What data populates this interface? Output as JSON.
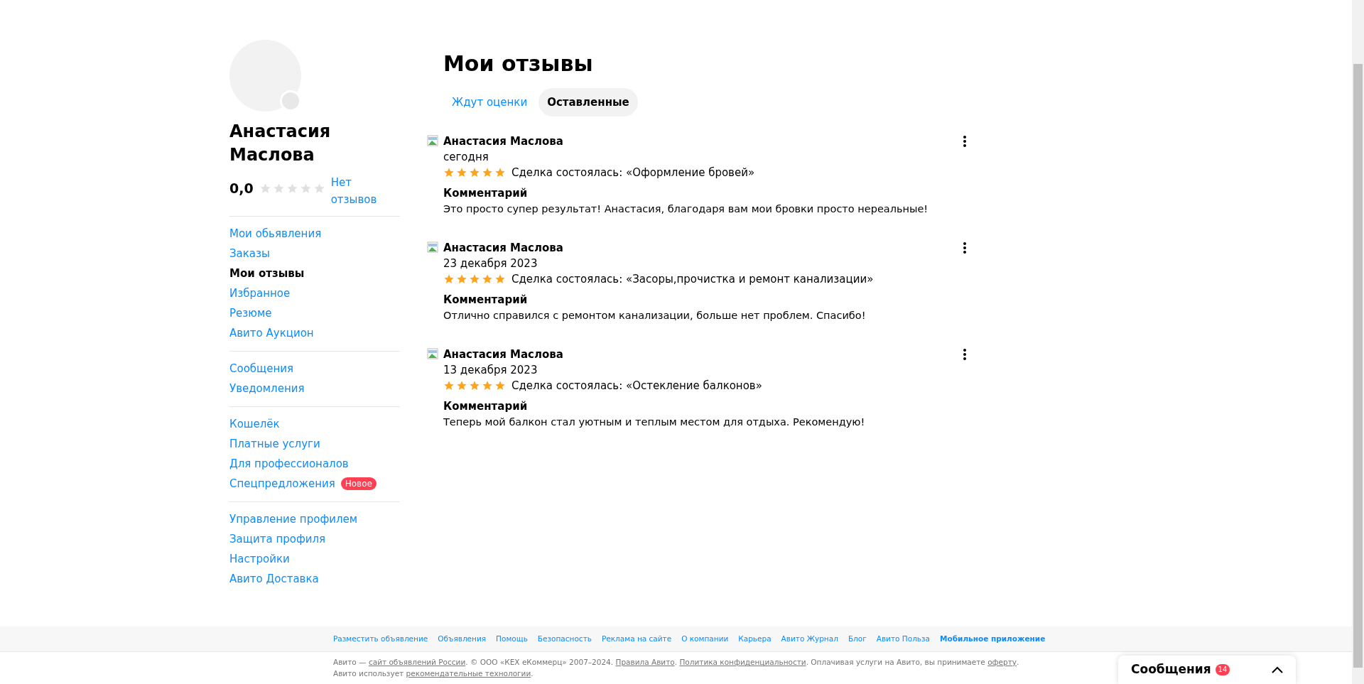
{
  "profile": {
    "name": "Анастасия Маслова",
    "rating": "0,0",
    "stars": 0,
    "reviews_link": "Нет отзывов"
  },
  "sidebar": {
    "groups": [
      {
        "items": [
          {
            "label": "Мои обьявления",
            "selected": false
          },
          {
            "label": "Заказы",
            "selected": false
          },
          {
            "label": "Мои отзывы",
            "selected": true
          },
          {
            "label": "Избранное",
            "selected": false
          },
          {
            "label": "Резюме",
            "selected": false
          },
          {
            "label": "Авито Аукцион",
            "selected": false
          }
        ]
      },
      {
        "items": [
          {
            "label": "Сообщения",
            "selected": false
          },
          {
            "label": "Уведомления",
            "selected": false
          }
        ]
      },
      {
        "items": [
          {
            "label": "Кошелёк",
            "selected": false
          },
          {
            "label": "Платные услуги",
            "selected": false
          },
          {
            "label": "Для профессионалов",
            "selected": false
          },
          {
            "label": "Спецпредложения",
            "selected": false,
            "badge": "Новое"
          }
        ]
      },
      {
        "items": [
          {
            "label": "Управление профилем",
            "selected": false
          },
          {
            "label": "Защита профиля",
            "selected": false
          },
          {
            "label": "Настройки",
            "selected": false
          },
          {
            "label": "Авито Доставка",
            "selected": false
          }
        ]
      }
    ]
  },
  "page": {
    "title": "Мои отзывы",
    "tabs": [
      {
        "label": "Ждут оценки",
        "selected": false
      },
      {
        "label": "Оставленные",
        "selected": true
      }
    ]
  },
  "reviews": [
    {
      "author": "Анастасия Маслова",
      "date": "сегодня",
      "stars": 5,
      "deal": "Сделка состоялась: «Оформление бровей»",
      "comment_label": "Комментарий",
      "comment": "Это просто супер результат! Анастасия, благодаря вам мои бровки просто нереальные!"
    },
    {
      "author": "Анастасия Маслова",
      "date": "23 декабря 2023",
      "stars": 5,
      "deal": "Сделка состоялась: «Засоры,прочистка и ремонт канализации»",
      "comment_label": "Комментарий",
      "comment": "Отлично справился с ремонтом канализации, больше нет проблем. Спасибо!"
    },
    {
      "author": "Анастасия Маслова",
      "date": "13 декабря 2023",
      "stars": 5,
      "deal": "Сделка состоялась: «Остекление балконов»",
      "comment_label": "Комментарий",
      "comment": "Теперь мой балкон стал уютным и теплым местом для отдыха. Рекомендую!"
    }
  ],
  "footer": {
    "links": [
      {
        "label": "Разместить объявление",
        "bold": false
      },
      {
        "label": "Объявления",
        "bold": false
      },
      {
        "label": "Помощь",
        "bold": false
      },
      {
        "label": "Безопасность",
        "bold": false
      },
      {
        "label": "Реклама на сайте",
        "bold": false
      },
      {
        "label": "О компании",
        "bold": false
      },
      {
        "label": "Карьера",
        "bold": false
      },
      {
        "label": "Авито Журнал",
        "bold": false
      },
      {
        "label": "Блог",
        "bold": false
      },
      {
        "label": "Авито Польза",
        "bold": false
      },
      {
        "label": "Мобильное приложение",
        "bold": true
      }
    ],
    "legal": [
      {
        "text": "Авито — ",
        "link": false
      },
      {
        "text": "сайт объявлений России",
        "link": true
      },
      {
        "text": ". © ООО «КЕХ еКоммерц» 2007–2024. ",
        "link": false
      },
      {
        "text": "Правила Авито",
        "link": true
      },
      {
        "text": ". ",
        "link": false
      },
      {
        "text": "Политика конфиденциальности",
        "link": true
      },
      {
        "text": ". Оплачивая услуги на Авито, вы принимаете ",
        "link": false
      },
      {
        "text": "оферту",
        "link": true
      },
      {
        "text": ". Авито использует ",
        "link": false
      },
      {
        "text": "рекомендательные технологии",
        "link": true
      },
      {
        "text": ".",
        "link": false
      }
    ]
  },
  "messages_widget": {
    "title": "Сообщения",
    "count": "14"
  }
}
